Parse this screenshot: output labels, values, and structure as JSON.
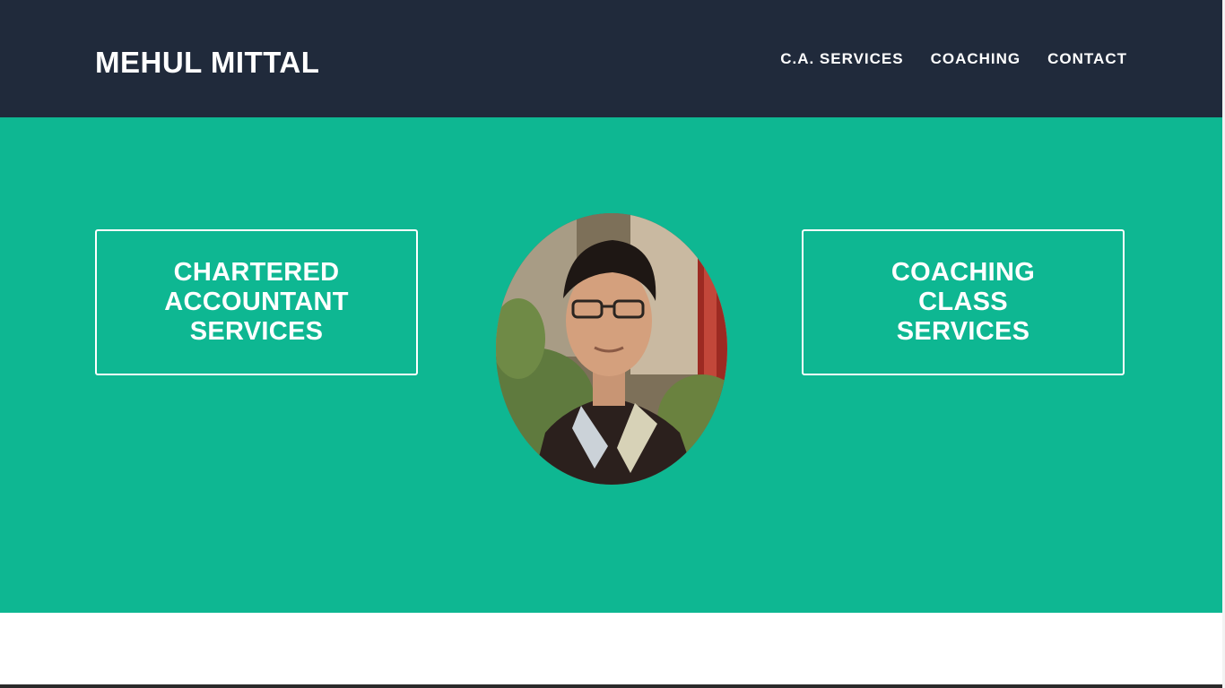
{
  "header": {
    "brand": "MEHUL MITTAL",
    "nav": [
      {
        "label": "C.A. SERVICES"
      },
      {
        "label": "COACHING"
      },
      {
        "label": "CONTACT"
      }
    ]
  },
  "hero": {
    "left_card": {
      "label": "CHARTERED ACCOUNTANT SERVICES"
    },
    "right_card": {
      "label": "COACHING CLASS SERVICES"
    }
  },
  "colors": {
    "header_bg": "#202a3b",
    "hero_bg": "#0eb792",
    "text": "#ffffff"
  }
}
